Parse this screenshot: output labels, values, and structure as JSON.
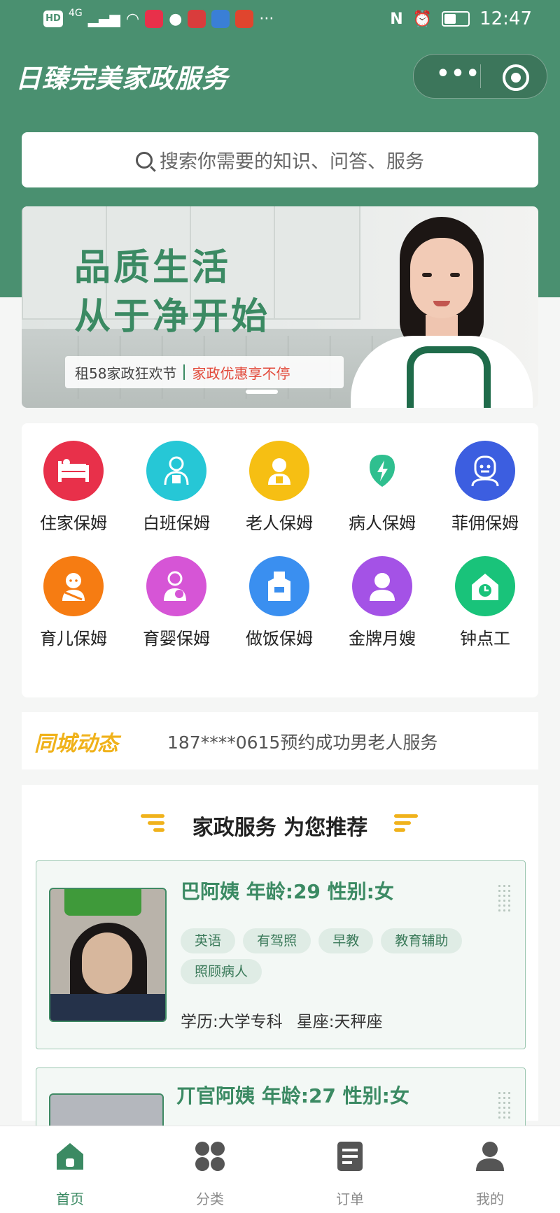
{
  "status_bar": {
    "network_badge": "HD",
    "signal": "4G",
    "time": "12:47",
    "more": "···"
  },
  "header": {
    "app_title": "日臻完美家政服务",
    "capsule_more": "•••"
  },
  "search": {
    "placeholder": "搜索你需要的知识、问答、服务"
  },
  "banner": {
    "headline_line1": "品质生活",
    "headline_line2": "从于净开始",
    "promo_left": "租58家政狂欢节",
    "promo_right": "家政优惠享不停"
  },
  "categories": [
    {
      "label": "住家保姆",
      "color": "#e8304a",
      "icon": "bed-icon"
    },
    {
      "label": "白班保姆",
      "color": "#26c7d6",
      "icon": "person-icon"
    },
    {
      "label": "老人保姆",
      "color": "#f6bf13",
      "icon": "elder-icon"
    },
    {
      "label": "病人保姆",
      "color": "#2fbf8f",
      "icon": "lightning-icon"
    },
    {
      "label": "菲佣保姆",
      "color": "#3c5ee0",
      "icon": "robot-face-icon"
    },
    {
      "label": "育儿保姆",
      "color": "#f67c12",
      "icon": "baby-icon"
    },
    {
      "label": "育婴保姆",
      "color": "#d655d6",
      "icon": "mother-baby-icon"
    },
    {
      "label": "做饭保姆",
      "color": "#3a8ff0",
      "icon": "apron-icon"
    },
    {
      "label": "金牌月嫂",
      "color": "#a452e6",
      "icon": "nanny-icon"
    },
    {
      "label": "钟点工",
      "color": "#19c37a",
      "icon": "house-clock-icon"
    }
  ],
  "city_news": {
    "badge": "同城动态",
    "text": "187****0615预约成功男老人服务"
  },
  "recommend": {
    "title": "家政服务 为您推荐",
    "cards": [
      {
        "name_line": "巴阿姨 年龄:29 性别:女",
        "tags": [
          "英语",
          "有驾照",
          "早教",
          "教育辅助",
          "照顾病人"
        ],
        "education": "学历:大学专科",
        "zodiac": "星座:天秤座"
      },
      {
        "name_line": "丌官阿姨 年龄:27 性别:女"
      }
    ]
  },
  "tabbar": {
    "items": [
      {
        "label": "首页",
        "active": true
      },
      {
        "label": "分类",
        "active": false
      },
      {
        "label": "订单",
        "active": false
      },
      {
        "label": "我的",
        "active": false
      }
    ],
    "active_color": "#3b8a63",
    "inactive_color": "#555555"
  },
  "colors": {
    "brand_green": "#4a9070",
    "accent_yellow": "#f0b21b",
    "promo_red": "#e24a3b"
  }
}
